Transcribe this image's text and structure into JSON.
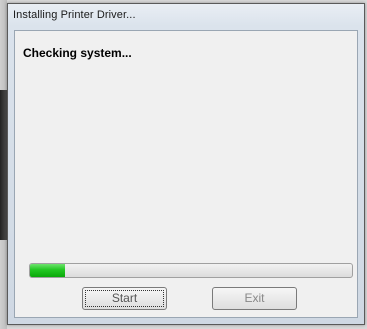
{
  "window": {
    "title": "Installing Printer Driver..."
  },
  "main": {
    "status_text": "Checking system...",
    "progress_fraction": 0.11
  },
  "buttons": {
    "start_label": "Start",
    "exit_label": "Exit"
  },
  "colors": {
    "progress_green": "#22c722"
  }
}
